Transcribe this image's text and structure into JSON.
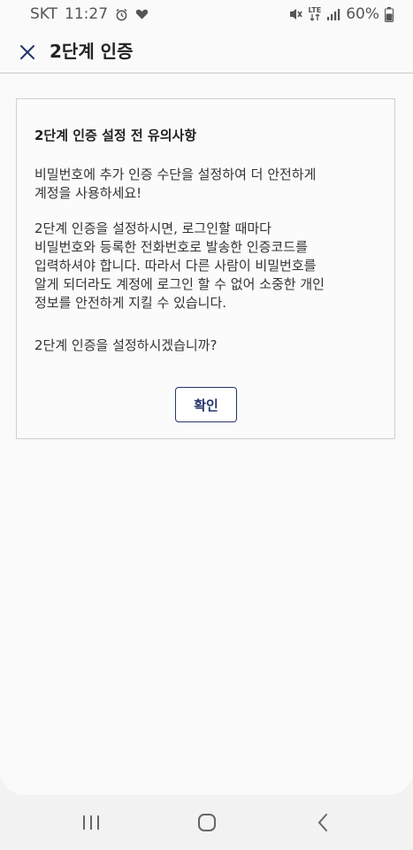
{
  "status_bar": {
    "carrier": "SKT",
    "time": "11:27",
    "network": "LTE",
    "battery": "60%"
  },
  "header": {
    "title": "2단계 인증"
  },
  "notice": {
    "title": "2단계 인증 설정 전 유의사항",
    "paragraph1": "비밀번호에 추가 인증 수단을 설정하여 더 안전하게\n계정을 사용하세요!",
    "paragraph2": "2단계 인증을 설정하시면, 로그인할 때마다\n비밀번호와 등록한 전화번호로 발송한 인증코드를\n입력하셔야 합니다. 따라서 다른 사람이 비밀번호를\n알게 되더라도 계정에 로그인 할 수 없어 소중한 개인\n정보를 안전하게 지킬 수 있습니다.",
    "question": "2단계 인증을 설정하시겠습니까?",
    "confirm_label": "확인"
  },
  "colors": {
    "accent": "#23356b",
    "background": "#fafafa"
  }
}
